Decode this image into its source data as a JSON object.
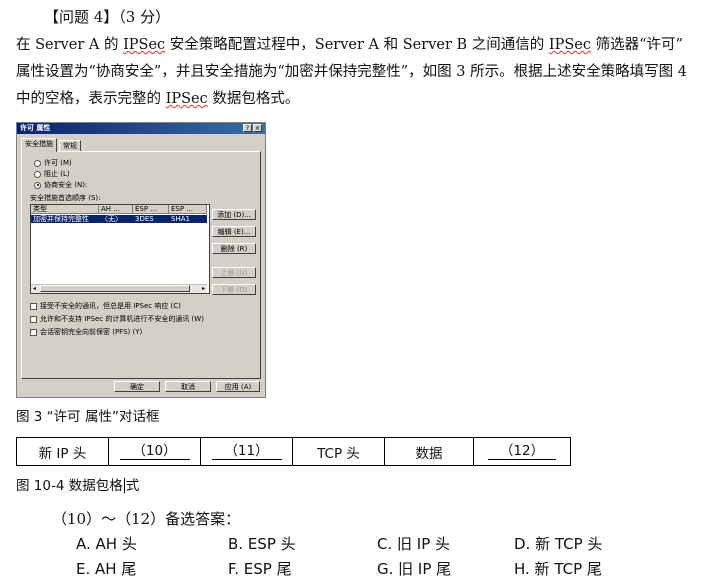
{
  "question": {
    "title": "【问题 4】（3 分）",
    "paragraph": {
      "before": "在 Server A 的 ",
      "ipsec1": "IPSec",
      "mid1": " 安全策略配置过程中，Server A 和 Server B 之间通信的 ",
      "ipsec2": "IPSec",
      "mid2": " 筛选器“许可” 属性设置为“协商安全”，并且安全措施为“加密并保持完整性”，如图 3 所示。根据上述安全策略填写图 4 中的空格，表示完整的 ",
      "ipsec3": "IPSec",
      "after": " 数据包格式。"
    }
  },
  "dialog": {
    "title": "许可 属性",
    "help_btn": "?",
    "close_btn": "×",
    "tabs": [
      "安全措施",
      "常规"
    ],
    "radios": [
      {
        "label": "许可 (M)",
        "checked": false
      },
      {
        "label": "阻止 (L)",
        "checked": false
      },
      {
        "label": "协商安全 (N):",
        "checked": true
      }
    ],
    "list_label": "安全措施首选顺序 (S):",
    "columns": [
      "类型",
      "AH ...",
      "ESP ...",
      "ESP ..."
    ],
    "row": [
      "加密并保持完整性",
      "〈无〉",
      "3DES",
      "SHA1"
    ],
    "side_buttons": [
      {
        "label": "添加 (D)...",
        "disabled": false
      },
      {
        "label": "编辑 (E)...",
        "disabled": false
      },
      {
        "label": "删除 (R)",
        "disabled": false
      },
      {
        "label": "上移 (U)",
        "disabled": true
      },
      {
        "label": "下移 (O)",
        "disabled": true
      }
    ],
    "checks": [
      "接受不安全的通讯，但总是用 IPSec 响应 (C)",
      "允许和不支持 IPSec 的计算机进行不安全的通讯 (W)",
      "会话密钥完全向前保密 (PFS) (Y)"
    ],
    "footer_buttons": [
      "确定",
      "取消",
      "应用 (A)"
    ]
  },
  "fig3_caption": "图 3   “许可  属性”对话框",
  "packet_format": [
    "新 IP 头",
    "（10）",
    "（11）",
    "TCP 头",
    "数据",
    "（12）"
  ],
  "fig4_caption_a": "图 10-4   数据包格",
  "fig4_caption_b": "式",
  "answers_intro": "（10）～（12）备选答案：",
  "options": [
    "A.  AH 头",
    "B.  ESP 头",
    "C.  旧 IP 头",
    "D.  新 TCP 头",
    "E.  AH 尾",
    "F.  ESP 尾",
    "G.  旧 IP 尾",
    "H.  新 TCP 尾"
  ]
}
